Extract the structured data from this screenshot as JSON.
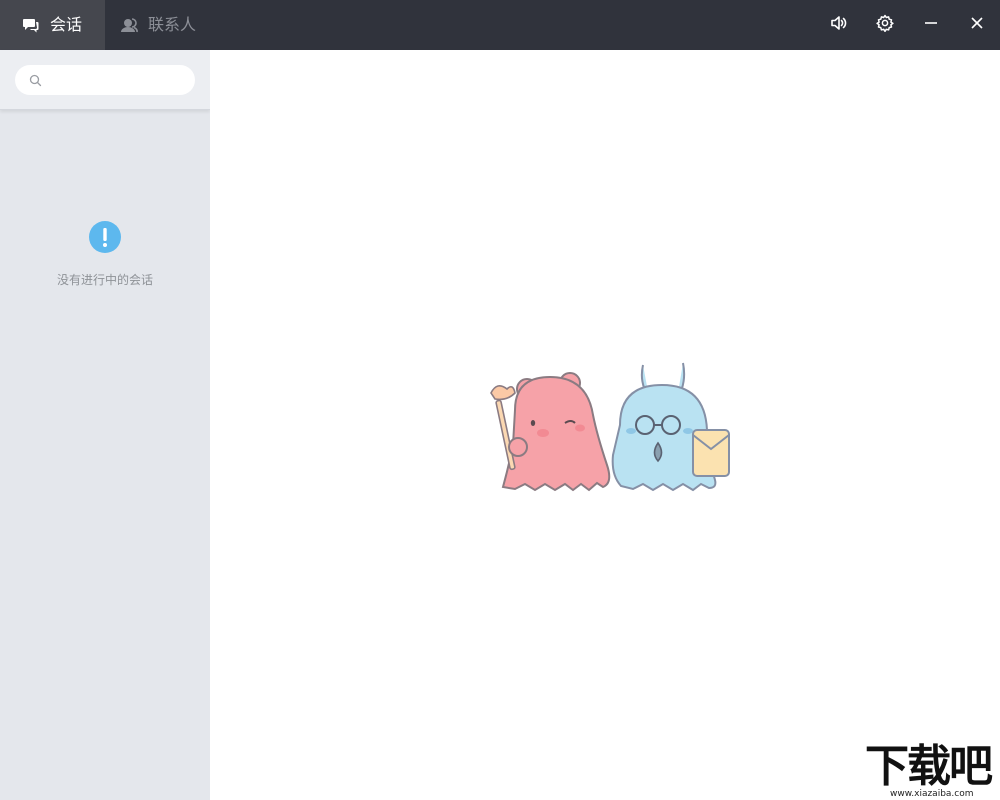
{
  "tabs": [
    {
      "label": "会话",
      "icon": "chat-bubble-icon",
      "active": true
    },
    {
      "label": "联系人",
      "icon": "contacts-icon",
      "active": false
    }
  ],
  "window_controls": [
    "volume-icon",
    "gear-icon",
    "minimize-icon",
    "close-icon"
  ],
  "search": {
    "placeholder": "",
    "value": ""
  },
  "empty_state": {
    "icon": "exclamation-icon",
    "message": "没有进行中的会话"
  },
  "main": {
    "illustration": "mascots-illustration"
  },
  "watermark": {
    "logo_text": "下载吧",
    "url": "www.xiazaiba.com"
  },
  "colors": {
    "titlebar": "#30333c",
    "active_tab": "#45474e",
    "sidebar": "#e4e7ec",
    "accent": "#5db8ee"
  }
}
